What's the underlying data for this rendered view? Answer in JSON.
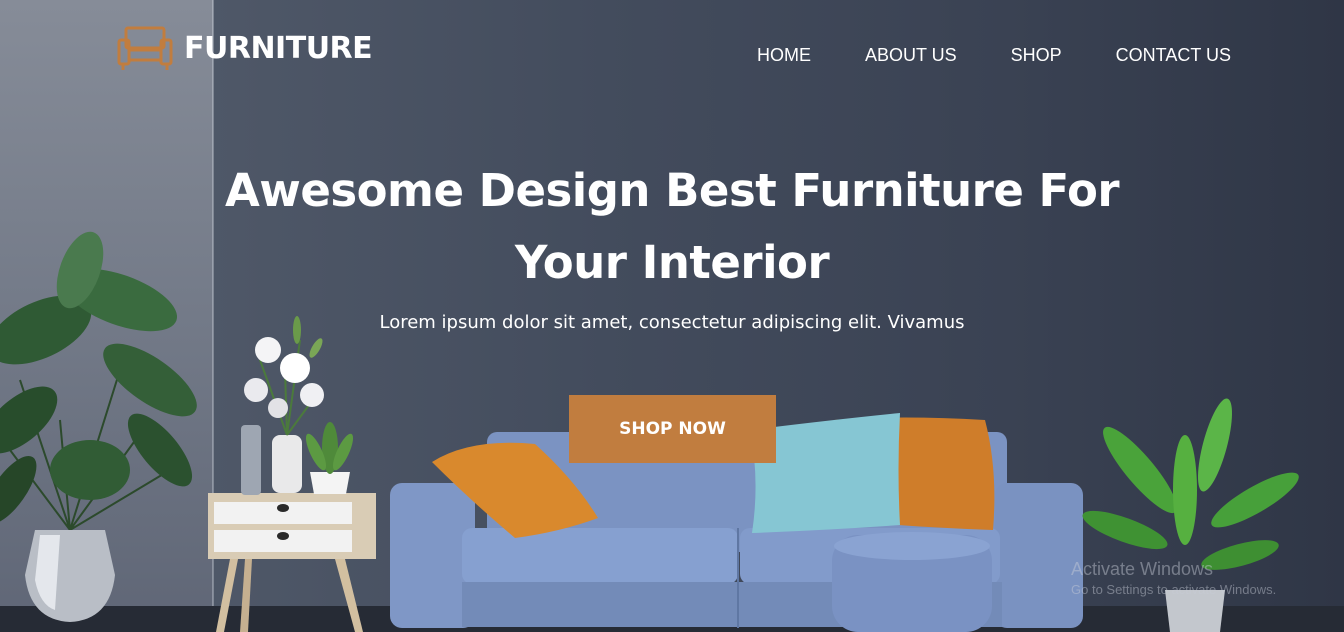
{
  "brand": {
    "name": "FURNITURE",
    "icon": "sofa-icon",
    "accent": "#c17d3f"
  },
  "nav": {
    "items": [
      {
        "label": "HOME"
      },
      {
        "label": "ABOUT US"
      },
      {
        "label": "SHOP"
      },
      {
        "label": "CONTACT US"
      }
    ]
  },
  "hero": {
    "title_line1": "Awesome Design Best Furniture For",
    "title_line2": "Your Interior",
    "subtitle": "Lorem ipsum dolor sit amet, consectetur adipiscing elit. Vivamus",
    "cta_label": "SHOP NOW"
  },
  "watermark": {
    "title": "Activate Windows",
    "subtitle": "Go to Settings to activate Windows."
  },
  "colors": {
    "accent": "#c17d3f",
    "sofa": "#7f97c6",
    "pillow_orange": "#d9892d",
    "pillow_teal": "#86c6d3"
  }
}
